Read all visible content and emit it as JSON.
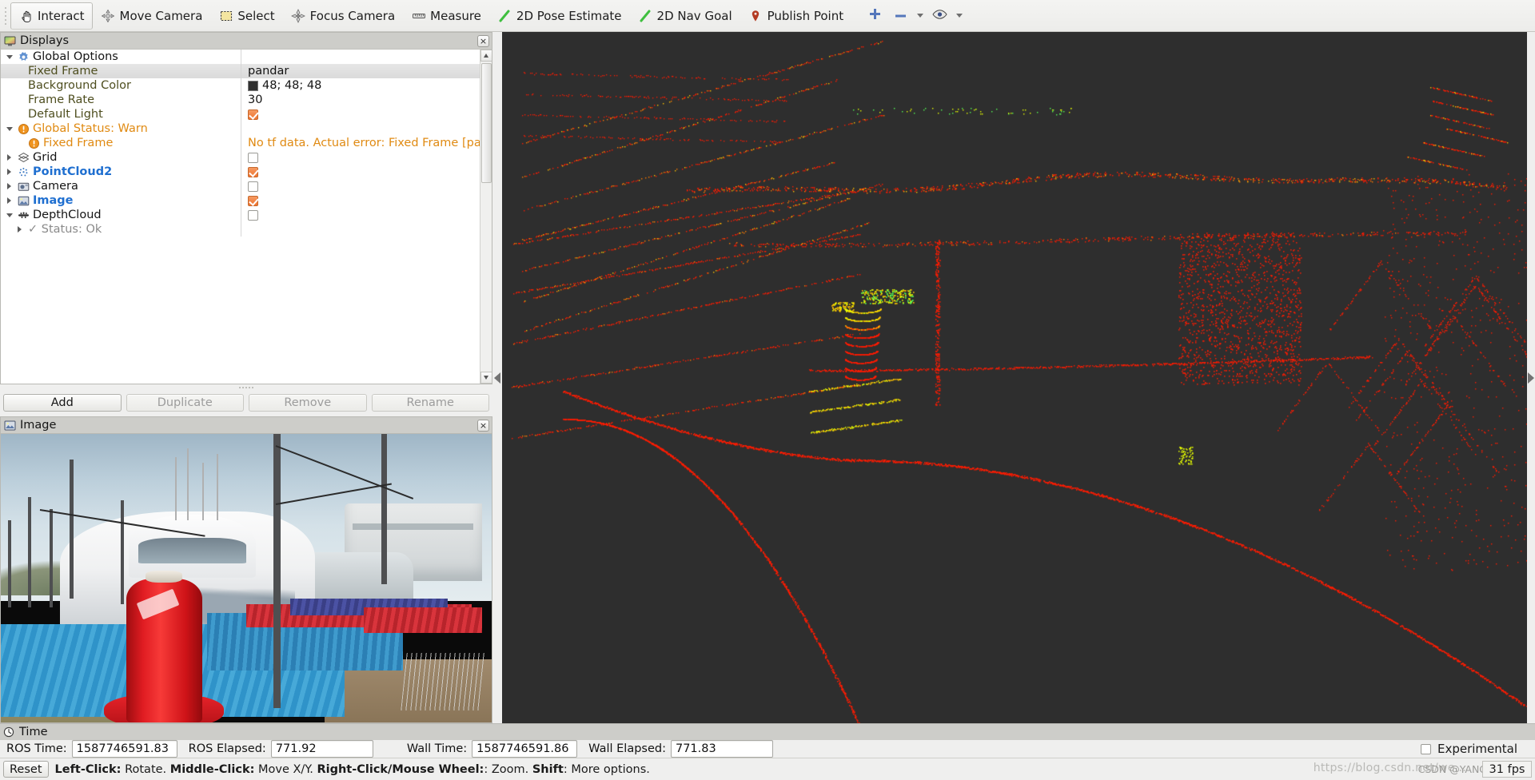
{
  "toolbar": {
    "buttons": [
      {
        "label": "Interact",
        "icon": "hand-cursor-icon",
        "checked": true
      },
      {
        "label": "Move Camera",
        "icon": "move-camera-icon",
        "checked": false
      },
      {
        "label": "Select",
        "icon": "select-rect-icon",
        "checked": false
      },
      {
        "label": "Focus Camera",
        "icon": "focus-camera-icon",
        "checked": false
      },
      {
        "label": "Measure",
        "icon": "ruler-icon",
        "checked": false
      },
      {
        "label": "2D Pose Estimate",
        "icon": "pose-arrow-icon",
        "checked": false
      },
      {
        "label": "2D Nav Goal",
        "icon": "nav-goal-arrow-icon",
        "checked": false
      },
      {
        "label": "Publish Point",
        "icon": "map-pin-icon",
        "checked": false
      }
    ],
    "right_tools": [
      "plus-icon",
      "minus-icon",
      "chevron-down-icon",
      "eye-icon",
      "chevron-down-icon"
    ]
  },
  "displays_panel": {
    "title": "Displays",
    "title_icon": "monitor-icon",
    "close_label": "×",
    "rows": [
      {
        "name": "Global Options",
        "value": "",
        "indent": 0,
        "twisty": "down",
        "icon": "gear-icon",
        "style": "plain",
        "ctl": "none"
      },
      {
        "name": "Fixed Frame",
        "value": "pandar",
        "indent": 1,
        "twisty": "none",
        "icon": "none",
        "style": "prop",
        "ctl": "text",
        "selected": true
      },
      {
        "name": "Background Color",
        "value": "48; 48; 48",
        "indent": 1,
        "twisty": "none",
        "icon": "none",
        "style": "prop",
        "ctl": "swatch"
      },
      {
        "name": "Frame Rate",
        "value": "30",
        "indent": 1,
        "twisty": "none",
        "icon": "none",
        "style": "prop",
        "ctl": "text"
      },
      {
        "name": "Default Light",
        "value": "",
        "indent": 1,
        "twisty": "none",
        "icon": "none",
        "style": "prop",
        "ctl": "check-on"
      },
      {
        "name": "Global Status: Warn",
        "value": "",
        "indent": 0,
        "twisty": "down",
        "icon": "warn-icon",
        "style": "warn",
        "ctl": "none"
      },
      {
        "name": "Fixed Frame",
        "value": "No tf data.  Actual error: Fixed Frame [pan…",
        "indent": 1,
        "twisty": "none",
        "icon": "warn-icon",
        "style": "warn",
        "ctl": "text"
      },
      {
        "name": "Grid",
        "value": "",
        "indent": 0,
        "twisty": "right",
        "icon": "grid-icon",
        "style": "plain",
        "ctl": "check-off"
      },
      {
        "name": "PointCloud2",
        "value": "",
        "indent": 0,
        "twisty": "right",
        "icon": "pointcloud-icon",
        "style": "blue",
        "ctl": "check-on"
      },
      {
        "name": "Camera",
        "value": "",
        "indent": 0,
        "twisty": "right",
        "icon": "camera-icon",
        "style": "plain",
        "ctl": "check-off"
      },
      {
        "name": "Image",
        "value": "",
        "indent": 0,
        "twisty": "right",
        "icon": "image-icon",
        "style": "blue",
        "ctl": "check-on"
      },
      {
        "name": "DepthCloud",
        "value": "",
        "indent": 0,
        "twisty": "down",
        "icon": "depthcloud-icon",
        "style": "plain",
        "ctl": "check-off"
      },
      {
        "name": "✓ Status: Ok",
        "value": "",
        "indent": 1,
        "twisty": "right",
        "icon": "none",
        "style": "gray",
        "ctl": "none"
      }
    ],
    "buttons": [
      {
        "label": "Add",
        "enabled": true
      },
      {
        "label": "Duplicate",
        "enabled": false
      },
      {
        "label": "Remove",
        "enabled": false
      },
      {
        "label": "Rename",
        "enabled": false
      }
    ]
  },
  "image_panel": {
    "title": "Image",
    "title_icon": "image-icon",
    "close_label": "×"
  },
  "view3d": {
    "background_color": "#2e2e2e",
    "point_colors": [
      "#ff1a00",
      "#ff4400",
      "#ff7a00",
      "#ffc400",
      "#e8ff00",
      "#55ff55"
    ]
  },
  "time_panel": {
    "title": "Time",
    "title_icon": "clock-icon",
    "fields": [
      {
        "label": "ROS Time:",
        "value": "1587746591.83"
      },
      {
        "label": "ROS Elapsed:",
        "value": "771.92"
      },
      {
        "label": "Wall Time:",
        "value": "1587746591.86"
      },
      {
        "label": "Wall Elapsed:",
        "value": "771.83"
      }
    ],
    "experimental_label": "Experimental",
    "experimental_checked": false
  },
  "statusbar": {
    "reset_label": "Reset",
    "hint_segments": [
      {
        "text": "Left-Click:",
        "bold": true
      },
      {
        "text": " Rotate. ",
        "bold": false
      },
      {
        "text": "Middle-Click:",
        "bold": true
      },
      {
        "text": " Move X/Y. ",
        "bold": false
      },
      {
        "text": "Right-Click/Mouse Wheel:",
        "bold": true
      },
      {
        "text": ": Zoom. ",
        "bold": false
      },
      {
        "text": "Shift",
        "bold": true
      },
      {
        "text": ": More options.",
        "bold": false
      }
    ],
    "fps": "31 fps",
    "watermark": "https://blog.csdn.net/we...",
    "watermark2": "CSDN @YANG"
  }
}
